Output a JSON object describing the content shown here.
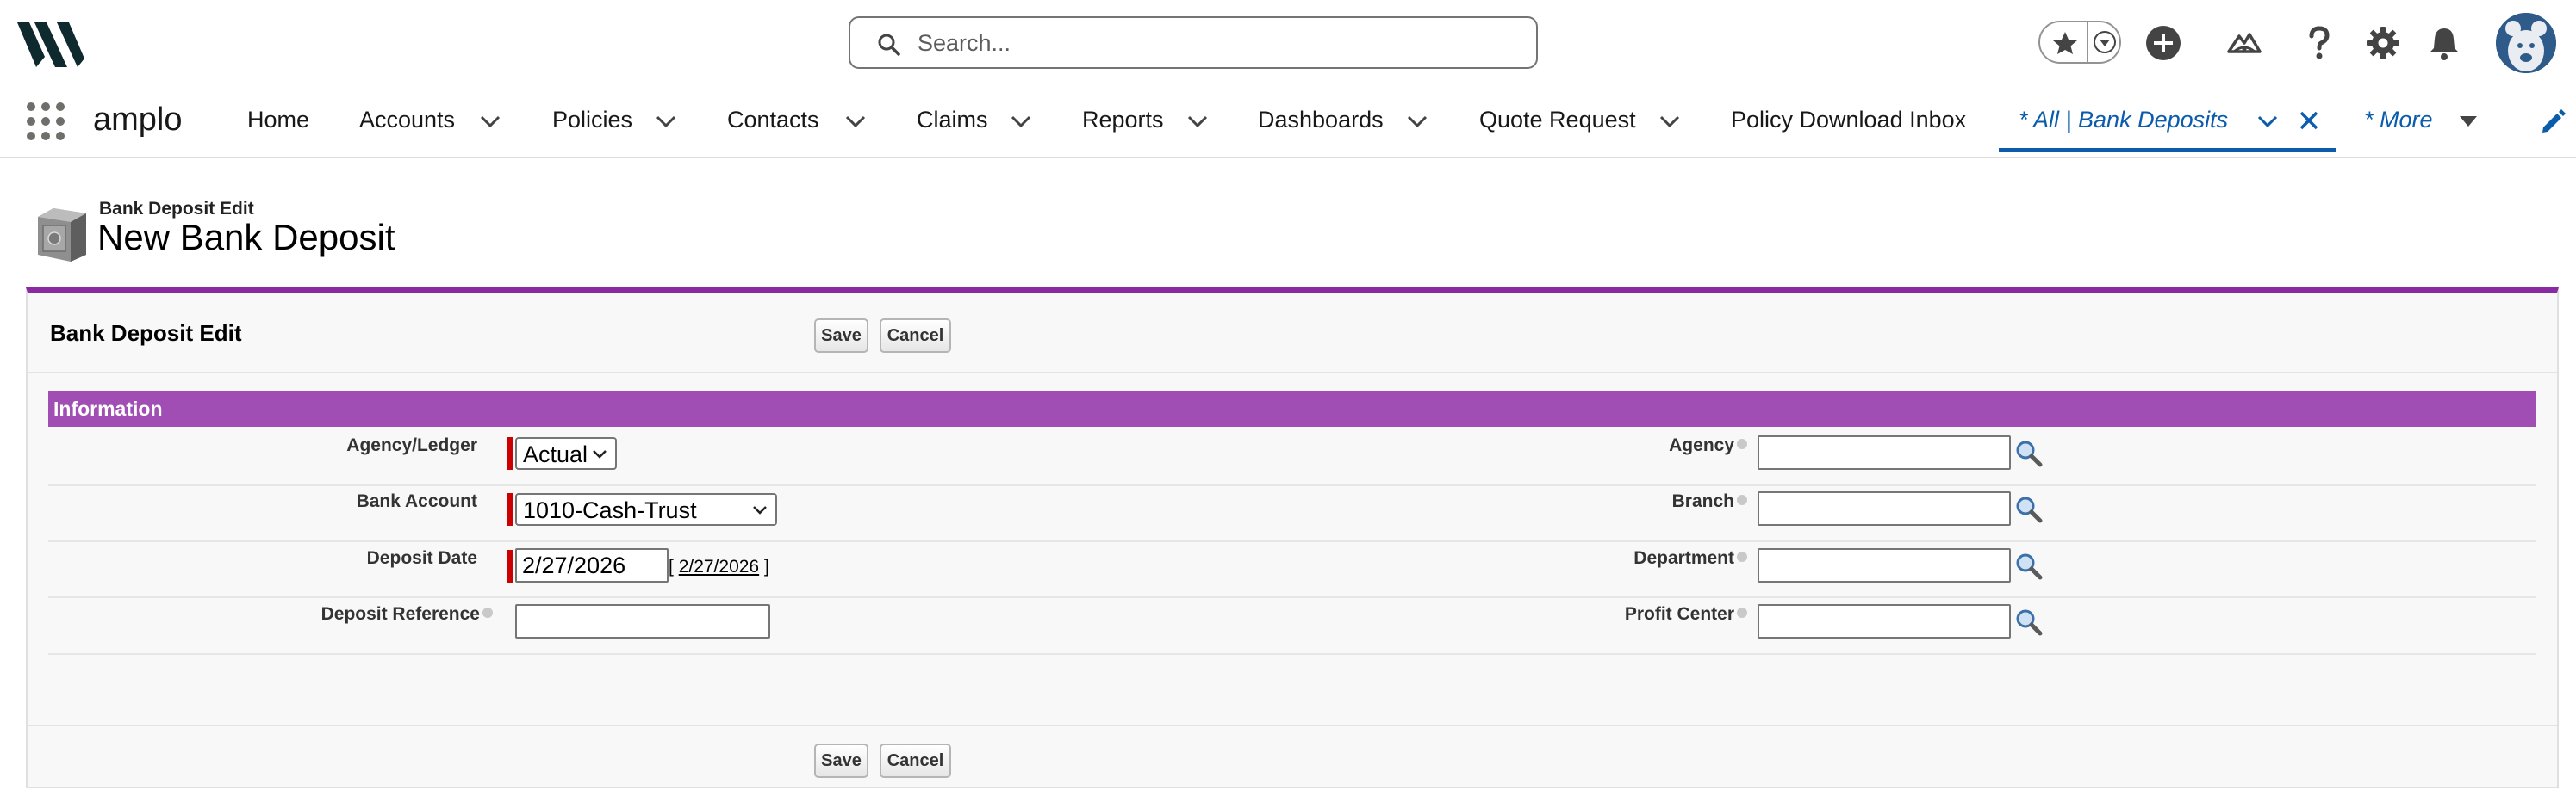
{
  "header": {
    "search_placeholder": "Search...",
    "icons": [
      "app-logo-icon",
      "search-icon",
      "star-icon",
      "chevron-down-icon",
      "add-icon",
      "trailhead-icon",
      "help-icon",
      "gear-icon",
      "bell-icon",
      "avatar"
    ]
  },
  "nav": {
    "app_name": "amplo",
    "items": [
      {
        "label": "Home"
      },
      {
        "label": "Accounts"
      },
      {
        "label": "Policies"
      },
      {
        "label": "Contacts"
      },
      {
        "label": "Claims"
      },
      {
        "label": "Reports"
      },
      {
        "label": "Dashboards"
      },
      {
        "label": "Quote Request"
      },
      {
        "label": "Policy Download Inbox"
      }
    ],
    "active_tab": "* All | Bank Deposits",
    "more_label": "* More"
  },
  "page": {
    "subtitle": "Bank Deposit Edit",
    "title": "New Bank Deposit"
  },
  "edit_block": {
    "title": "Bank Deposit Edit",
    "save_label": "Save",
    "cancel_label": "Cancel",
    "section_title": "Information",
    "fields": {
      "agency_ledger": {
        "label": "Agency/Ledger",
        "value": "Actual"
      },
      "bank_account": {
        "label": "Bank Account",
        "value": "1010-Cash-Trust"
      },
      "deposit_date": {
        "label": "Deposit Date",
        "value": "2/27/2026",
        "today_link": "2/27/2026",
        "bracket_open": "[",
        "bracket_close": "]"
      },
      "deposit_reference": {
        "label": "Deposit Reference",
        "value": ""
      },
      "agency": {
        "label": "Agency",
        "value": ""
      },
      "branch": {
        "label": "Branch",
        "value": ""
      },
      "department": {
        "label": "Department",
        "value": ""
      },
      "profit_center": {
        "label": "Profit Center",
        "value": ""
      }
    }
  },
  "colors": {
    "accent_purple": "#8a2aa0",
    "section_purple": "#a04eb4",
    "active_tab_blue": "#0b5cab",
    "required_red": "#cc0000"
  }
}
